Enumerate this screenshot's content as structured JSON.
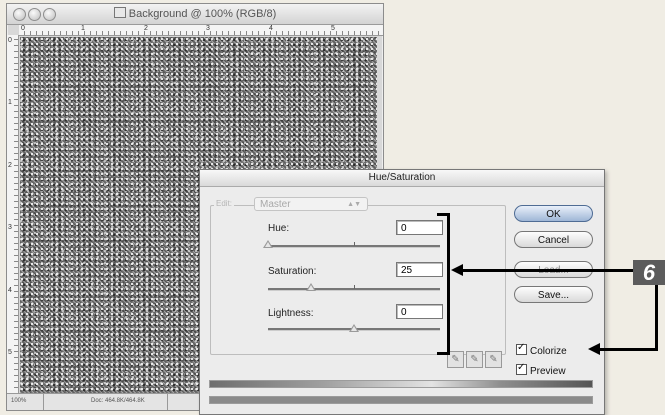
{
  "document_window": {
    "title": "Background @ 100% (RGB/8)",
    "ruler_top": [
      "0",
      "1",
      "2",
      "3",
      "4",
      "5"
    ],
    "ruler_left": [
      "0",
      "1",
      "2",
      "3",
      "4",
      "5"
    ],
    "status": {
      "zoom": "100%",
      "doc_size": "Doc: 464.8K/464.8K"
    }
  },
  "dialog": {
    "title": "Hue/Saturation",
    "edit_label": "Edit:",
    "edit_value": "Master",
    "hue": {
      "label": "Hue:",
      "value": "0",
      "level": 0
    },
    "saturation": {
      "label": "Saturation:",
      "value": "25",
      "level": 0.25
    },
    "lightness": {
      "label": "Lightness:",
      "value": "0",
      "level": 0.5
    },
    "buttons": {
      "ok": "OK",
      "cancel": "Cancel",
      "load": "Load...",
      "save": "Save..."
    },
    "colorize": {
      "label": "Colorize",
      "checked": true
    },
    "preview": {
      "label": "Preview",
      "checked": true
    }
  },
  "callout": {
    "step": "6"
  }
}
